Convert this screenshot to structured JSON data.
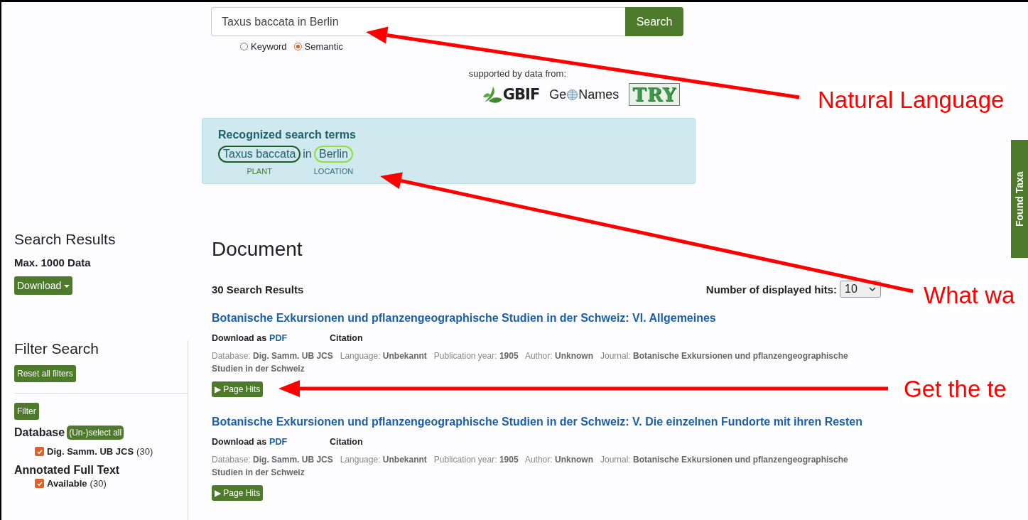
{
  "search": {
    "value": "Taxus baccata in Berlin",
    "button": "Search",
    "modes": [
      {
        "label": "Keyword",
        "selected": false
      },
      {
        "label": "Semantic",
        "selected": true
      }
    ]
  },
  "sources": {
    "caption": "supported by data from:",
    "logos": [
      {
        "kind": "gbif",
        "label": "GBIF"
      },
      {
        "kind": "geonames",
        "label_start": "Ge",
        "label_end": "Names"
      },
      {
        "kind": "try",
        "label": "TRY"
      }
    ]
  },
  "recognized": {
    "title": "Recognized search terms",
    "terms": [
      {
        "kind": "term",
        "text": "Taxus baccata",
        "type": "PLANT",
        "color": "#1d5c2a"
      },
      {
        "kind": "word",
        "text": "in"
      },
      {
        "kind": "term",
        "text": "Berlin",
        "type": "LOCATION",
        "color": "#8fe03c"
      }
    ]
  },
  "sidebar": {
    "results_title": "Search Results",
    "max": "Max. 1000 Data",
    "download": "Download",
    "filter_title": "Filter Search",
    "reset": "Reset all filters",
    "filter_button": "Filter",
    "groups": [
      {
        "title": "Database",
        "toggle": "(Un-)select all",
        "options": [
          {
            "label": "Dig. Samm. UB JCS",
            "count": "(30)",
            "checked": true
          }
        ]
      },
      {
        "title": "Annotated Full Text",
        "options": [
          {
            "label": "Available",
            "count": "(30)",
            "checked": true
          }
        ]
      }
    ]
  },
  "main": {
    "heading": "Document",
    "count": "30 Search Results",
    "hits_label": "Number of displayed hits:",
    "hits_value": "10",
    "results": [
      {
        "title": "Botanische Exkursionen und pflanzengeographische Studien in der Schweiz: VI. Allgemeines",
        "download_label": "Download as",
        "pdf": "PDF",
        "citation": "Citation",
        "meta": "Database: **Dig. Samm. UB JCS**   Language: **Unbekannt**   Publication year: **1905**   Author: **Unknown**   Journal: **Botanische Exkursionen und pflanzengeographische Studien in der Schweiz**",
        "page_hits": "▶ Page Hits"
      },
      {
        "title": "Botanische Exkursionen und pflanzengeographische Studien in der Schweiz: V. Die einzelnen Fundorte mit ihren Resten",
        "download_label": "Download as",
        "pdf": "PDF",
        "citation": "Citation",
        "meta": "Database: **Dig. Samm. UB JCS**   Language: **Unbekannt**   Publication year: **1905**   Author: **Unknown**   Journal: **Botanische Exkursionen und pflanzengeographische Studien in der Schweiz**",
        "page_hits": "▶ Page Hits"
      }
    ]
  },
  "side_tab": "Found Taxa",
  "annotations": [
    {
      "text": "Natural Language"
    },
    {
      "text": "What wa"
    },
    {
      "text": "Get the te"
    }
  ]
}
